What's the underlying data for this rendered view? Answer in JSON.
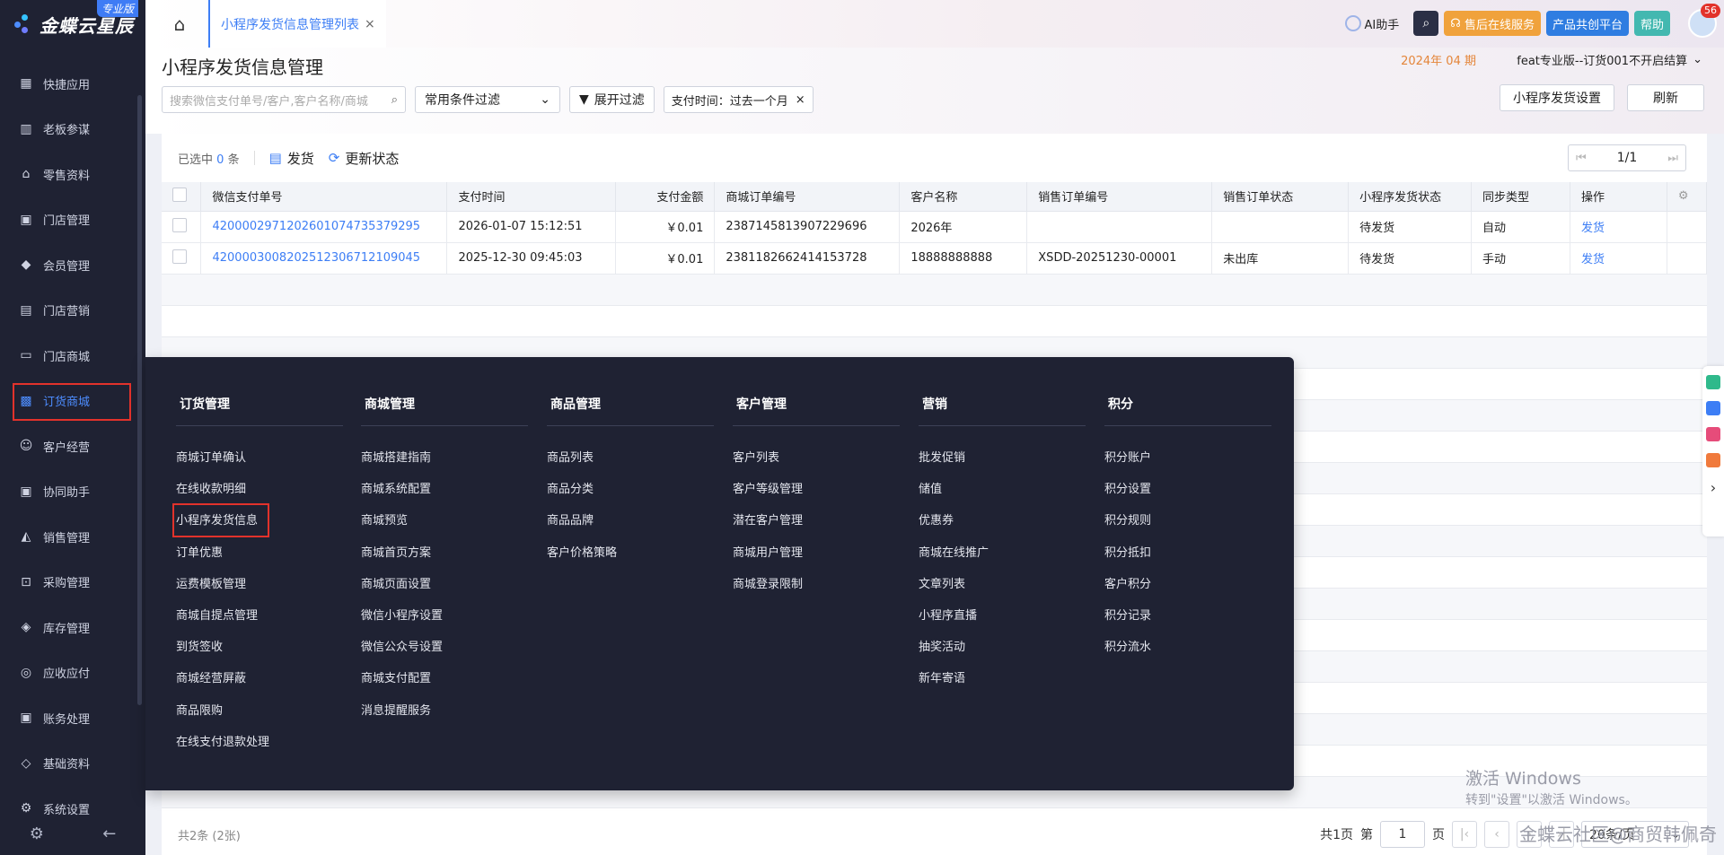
{
  "app": {
    "brand": "金蝶云星辰",
    "edition": "专业版"
  },
  "sidebar": {
    "items": [
      {
        "label": "快捷应用",
        "icon": "apps-icon"
      },
      {
        "label": "老板参谋",
        "icon": "chart-icon"
      },
      {
        "label": "零售资料",
        "icon": "basket-icon"
      },
      {
        "label": "门店管理",
        "icon": "store-icon"
      },
      {
        "label": "会员管理",
        "icon": "diamond-icon"
      },
      {
        "label": "门店营销",
        "icon": "clipboard-icon"
      },
      {
        "label": "门店商城",
        "icon": "shop-icon"
      },
      {
        "label": "订货商城",
        "icon": "bag-icon"
      },
      {
        "label": "客户经营",
        "icon": "user-icon"
      },
      {
        "label": "协同助手",
        "icon": "contact-icon"
      },
      {
        "label": "销售管理",
        "icon": "sales-icon"
      },
      {
        "label": "采购管理",
        "icon": "cart-icon"
      },
      {
        "label": "库存管理",
        "icon": "box-icon"
      },
      {
        "label": "应收应付",
        "icon": "money-icon"
      },
      {
        "label": "账务处理",
        "icon": "ledger-icon"
      },
      {
        "label": "基础资料",
        "icon": "layers-icon"
      },
      {
        "label": "系统设置",
        "icon": "settings-icon"
      }
    ],
    "active_index": 7
  },
  "topbar": {
    "tab_label": "小程序发货信息管理列表",
    "tab_close": "×",
    "ai_label": "AI助手",
    "service_label": "售后在线服务",
    "platform_label": "产品共创平台",
    "help_label": "帮助",
    "notification_count": "56",
    "colors": {
      "service": "#f0a23c",
      "platform": "#2f7de1",
      "help": "#43b8b0"
    }
  },
  "page": {
    "title": "小程序发货信息管理",
    "period": "2024年 04 期",
    "org": "feat专业版--订货001不开启结算"
  },
  "toolbar": {
    "search_placeholder": "搜索微信支付单号/客户,客户名称/商城",
    "filter_select": "常用条件过滤",
    "expand_filter": "展开过滤",
    "chip_label": "支付时间：过去一个月",
    "chip_close": "×",
    "settings_button": "小程序发货设置",
    "refresh_button": "刷新"
  },
  "list_tools": {
    "selected_prefix": "已选中",
    "selected_count": "0",
    "selected_suffix": "条",
    "ship_button": "发货",
    "update_status_button": "更新状态",
    "page_indicator": "1/1"
  },
  "table": {
    "columns": [
      "微信支付单号",
      "支付时间",
      "支付金额",
      "商城订单编号",
      "客户名称",
      "销售订单编号",
      "销售订单状态",
      "小程序发货状态",
      "同步类型",
      "操作"
    ],
    "rows": [
      {
        "pay_no": "4200002971202601074735379295",
        "pay_time": "2026-01-07 15:12:51",
        "amount": "￥0.01",
        "mall_order": "2387145813907229696",
        "customer": "2026年",
        "sales_order": "",
        "sales_status": "",
        "ship_status": "待发货",
        "sync": "自动",
        "action": "发货"
      },
      {
        "pay_no": "4200003008202512306712109045",
        "pay_time": "2025-12-30 09:45:03",
        "amount": "￥0.01",
        "mall_order": "2381182662414153728",
        "customer": "18888888888",
        "sales_order": "XSDD-20251230-00001",
        "sales_status": "未出库",
        "ship_status": "待发货",
        "sync": "手动",
        "action": "发货"
      }
    ]
  },
  "footer": {
    "total": "共2条 (2张)",
    "pages_label": "共1页",
    "page_prefix": "第",
    "current_page": "1",
    "page_suffix": "页",
    "page_size": "20条/页"
  },
  "mega_menu": {
    "columns": [
      {
        "title": "订货管理",
        "items": [
          "商城订单确认",
          "在线收款明细",
          "小程序发货信息",
          "订单优惠",
          "运费模板管理",
          "商城自提点管理",
          "到货签收",
          "商城经营屏蔽",
          "商品限购",
          "在线支付退款处理"
        ]
      },
      {
        "title": "商城管理",
        "items": [
          "商城搭建指南",
          "商城系统配置",
          "商城预览",
          "商城首页方案",
          "商城页面设置",
          "微信小程序设置",
          "微信公众号设置",
          "商城支付配置",
          "消息提醒服务"
        ]
      },
      {
        "title": "商品管理",
        "items": [
          "商品列表",
          "商品分类",
          "商品品牌",
          "客户价格策略"
        ]
      },
      {
        "title": "客户管理",
        "items": [
          "客户列表",
          "客户等级管理",
          "潜在客户管理",
          "商城用户管理",
          "商城登录限制"
        ]
      },
      {
        "title": "营销",
        "items": [
          "批发促销",
          "储值",
          "优惠券",
          "商城在线推广",
          "文章列表",
          "小程序直播",
          "抽奖活动",
          "新年寄语"
        ]
      },
      {
        "title": "积分",
        "items": [
          "积分账户",
          "积分设置",
          "积分规则",
          "积分抵扣",
          "客户积分",
          "积分记录",
          "积分流水"
        ]
      }
    ]
  },
  "overlay": {
    "windows_title": "激活 Windows",
    "windows_sub": "转到\"设置\"以激活 Windows。",
    "community": "金蝶云社区@商贸韩佩奇"
  }
}
